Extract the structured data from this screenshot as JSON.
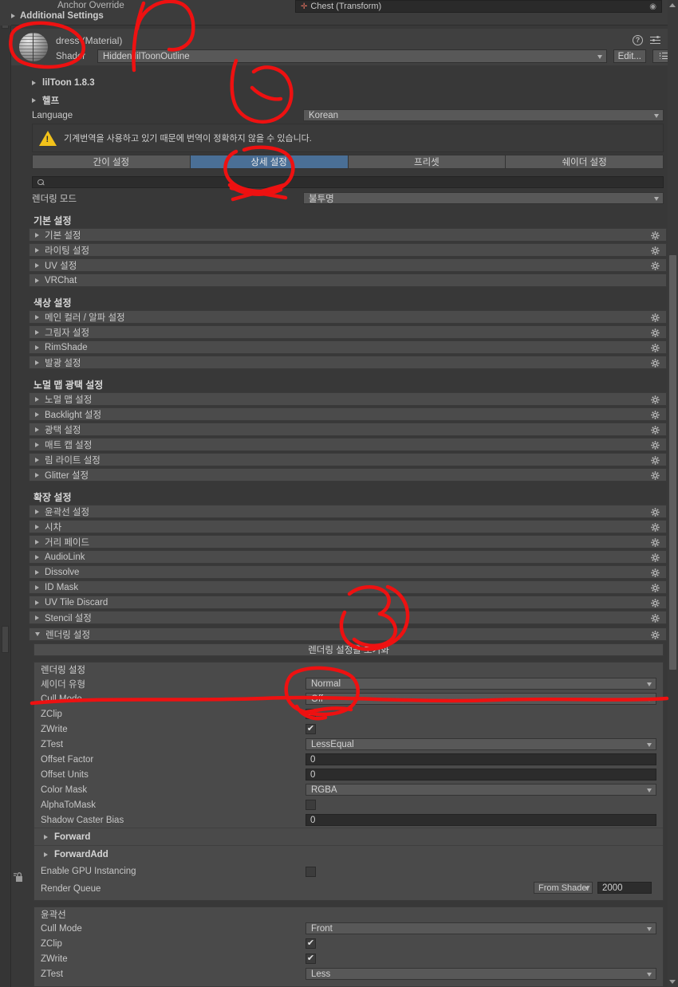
{
  "window": {
    "anchor_override_label": "Anchor Override",
    "anchor_override_value": "Chest (Transform)",
    "additional_settings_label": "Additional Settings"
  },
  "material": {
    "title": "dress (Material)",
    "shader_label": "Shader",
    "shader_value": "Hidden/lilToonOutline",
    "edit_label": "Edit...",
    "icons": {
      "help": "help-icon",
      "preset": "preset-icon",
      "kebab": "kebab-menu-icon",
      "list": "list-select-icon",
      "preview": "material-sphere-preview"
    }
  },
  "foldouts": {
    "version": "lilToon 1.8.3",
    "help": "헬프"
  },
  "language": {
    "label": "Language",
    "value": "Korean"
  },
  "warning": {
    "text": "기계번역을 사용하고 있기 때문에 번역이 정확하지 않을 수 있습니다.",
    "icon": "warning-triangle-icon"
  },
  "tabs": [
    {
      "label": "간이 설정",
      "active": false
    },
    {
      "label": "상세 설정",
      "active": true
    },
    {
      "label": "프리셋",
      "active": false
    },
    {
      "label": "쉐이더 설정",
      "active": false
    }
  ],
  "search": {
    "value": "",
    "placeholder": "",
    "icon": "search-icon"
  },
  "render_mode": {
    "label": "렌더링 모드",
    "value": "불투명"
  },
  "groups": [
    {
      "title": "기본 설정",
      "items": [
        "기본 설정",
        "라이팅 설정",
        "UV 설정",
        "VRChat"
      ]
    },
    {
      "title": "색상 설정",
      "items": [
        "메인 컬러 / 알파 설정",
        "그림자 설정",
        "RimShade",
        "발광 설정"
      ]
    },
    {
      "title": "노멀 맵 광택 설정",
      "items": [
        "노멀 맵 설정",
        "Backlight 설정",
        "광택 설정",
        "매트 캡 설정",
        "림 라이트 설정",
        "Glitter 설정"
      ]
    },
    {
      "title": "확장 설정",
      "items": [
        "윤곽선 설정",
        "시차",
        "거리 페이드",
        "AudioLink",
        "Dissolve",
        "ID Mask",
        "UV Tile Discard",
        "Stencil 설정",
        "렌더링 설정"
      ]
    }
  ],
  "rendering": {
    "reset_button": "렌더링 설정을 초기화",
    "panel_title": "렌더링 설정",
    "rows": [
      {
        "label": "셰이더 유형",
        "type": "dropdown",
        "value": "Normal"
      },
      {
        "label": "Cull Mode",
        "type": "dropdown",
        "value": "Off"
      },
      {
        "label": "ZClip",
        "type": "checkbox",
        "value": true
      },
      {
        "label": "ZWrite",
        "type": "checkbox",
        "value": true
      },
      {
        "label": "ZTest",
        "type": "dropdown",
        "value": "LessEqual"
      },
      {
        "label": "Offset Factor",
        "type": "field",
        "value": "0"
      },
      {
        "label": "Offset Units",
        "type": "field",
        "value": "0"
      },
      {
        "label": "Color Mask",
        "type": "dropdown",
        "value": "RGBA"
      },
      {
        "label": "AlphaToMask",
        "type": "checkbox",
        "value": false
      },
      {
        "label": "Shadow Caster Bias",
        "type": "field",
        "value": "0"
      }
    ],
    "subfolds": [
      "Forward",
      "ForwardAdd"
    ],
    "gpu_instancing": {
      "label": "Enable GPU Instancing",
      "value": false
    },
    "render_queue": {
      "label": "Render Queue",
      "source": "From Shader",
      "value": "2000"
    }
  },
  "outline": {
    "panel_title": "윤곽선",
    "rows": [
      {
        "label": "Cull Mode",
        "type": "dropdown",
        "value": "Front"
      },
      {
        "label": "ZClip",
        "type": "checkbox",
        "value": true
      },
      {
        "label": "ZWrite",
        "type": "checkbox",
        "value": true
      },
      {
        "label": "ZTest",
        "type": "dropdown",
        "value": "Less"
      }
    ]
  },
  "annotations": {
    "marks": [
      "1",
      "2",
      "3",
      "underline-cull-mode"
    ],
    "color": "#ee1111"
  }
}
